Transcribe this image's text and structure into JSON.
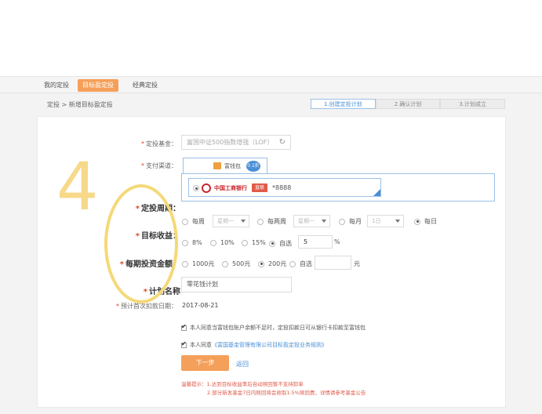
{
  "tabs": [
    {
      "label": "我的定投",
      "active": false
    },
    {
      "label": "目标盈定投",
      "active": true
    },
    {
      "label": "经典定投",
      "active": false
    }
  ],
  "breadcrumb": "定投 > 新增目标盈定投",
  "steps": [
    {
      "label": "1.创建定投计划",
      "active": true
    },
    {
      "label": "2.确认计划",
      "active": false
    },
    {
      "label": "3.计划成立",
      "active": false
    }
  ],
  "form": {
    "fund": {
      "label": "定投基金：",
      "placeholder": "富国中证500指数增强（LOF）"
    },
    "channel": {
      "label": "支付渠道：",
      "tab_label": "富钱包",
      "tab_badge": "0.1折",
      "bank_name": "中国工商银行",
      "bank_tag": "直联",
      "card_tail": "*8888"
    },
    "period": {
      "label": "定投周期：",
      "options": [
        "每周",
        "每两周",
        "每月",
        "每日"
      ],
      "selected": "每日",
      "weekday_select": "星期一",
      "weekday_select2": "星期一",
      "day_select": "1日"
    },
    "target": {
      "label": "目标收益：",
      "options": [
        "8%",
        "10%",
        "15%",
        "自选"
      ],
      "selected": "自选",
      "custom_value": "5",
      "unit": "%"
    },
    "amount": {
      "label": "每期投资金额：",
      "options": [
        "1000元",
        "500元",
        "200元",
        "自选"
      ],
      "selected": "200元",
      "unit": "元"
    },
    "plan_name": {
      "label": "计划名称",
      "value": "零花钱计划"
    },
    "first_date": {
      "label": "预计首次扣款日期：",
      "value": "2017-08-21"
    },
    "agree1": "本人同意当富钱包账户余额不足时，定投扣款日可从银行卡扣款至富钱包",
    "agree2_prefix": "本人同意",
    "agree2_link": "《富国基金管理有限公司目标盈定投业务规则》",
    "next_button": "下一步",
    "back_link": "返回",
    "tip1": "温馨提示：1.达到目标收益率后自动赎回暂不支持卸单",
    "tip2": "2.部分新发基金7日内赎回将会收取1.5%赎回费，详情请参考基金公告"
  },
  "overlay": {
    "number": "4"
  },
  "colors": {
    "accent": "#f5a05a",
    "link": "#4a8fd6",
    "required": "#e04b2c",
    "highlight": "#f5d978"
  }
}
